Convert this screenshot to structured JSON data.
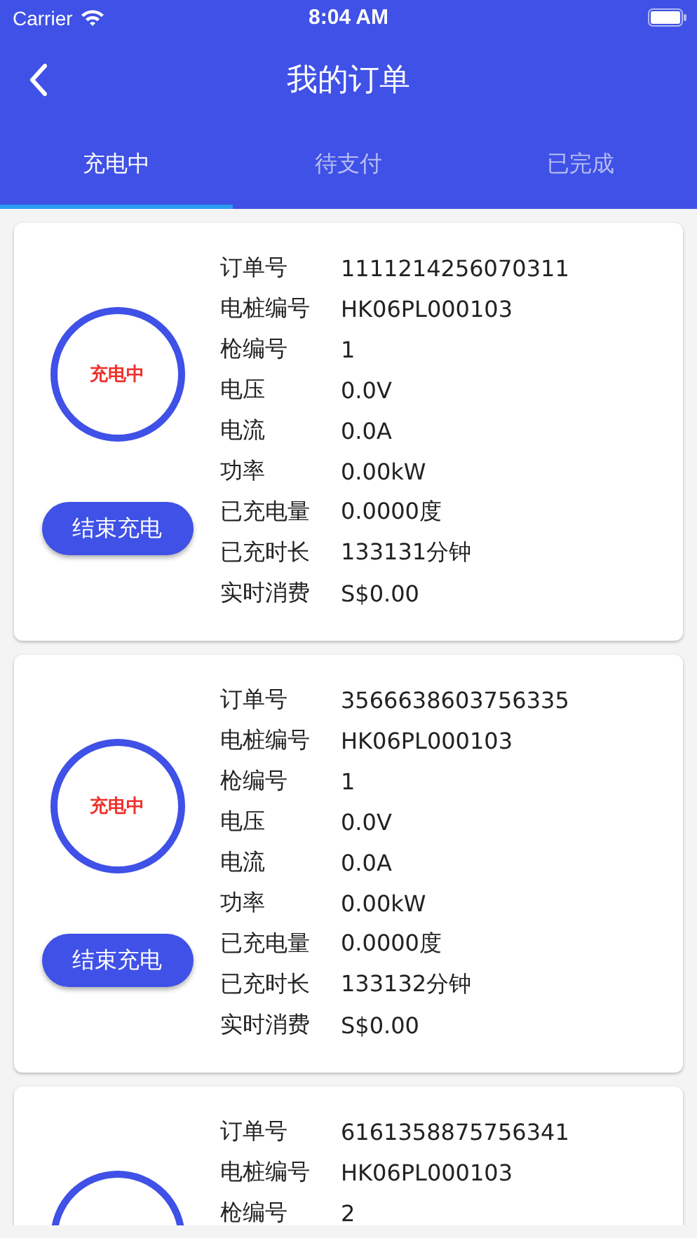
{
  "status_bar": {
    "carrier": "Carrier",
    "time": "8:04 AM"
  },
  "header": {
    "title": "我的订单"
  },
  "tabs": [
    {
      "label": "充电中",
      "selected": true
    },
    {
      "label": "待支付",
      "selected": false
    },
    {
      "label": "已完成",
      "selected": false
    }
  ],
  "orders": [
    {
      "status": "充电中",
      "button": "结束充电",
      "fields": [
        {
          "label": "订单号",
          "value": "1111214256070311"
        },
        {
          "label": "电桩编号",
          "value": "HK06PL000103"
        },
        {
          "label": "枪编号",
          "value": "1"
        },
        {
          "label": "电压",
          "value": "0.0V"
        },
        {
          "label": "电流",
          "value": "0.0A"
        },
        {
          "label": "功率",
          "value": "0.00kW"
        },
        {
          "label": "已充电量",
          "value": "0.0000度"
        },
        {
          "label": "已充时长",
          "value": "133131分钟"
        },
        {
          "label": "实时消费",
          "value": "S$0.00"
        }
      ]
    },
    {
      "status": "充电中",
      "button": "结束充电",
      "fields": [
        {
          "label": "订单号",
          "value": "3566638603756335"
        },
        {
          "label": "电桩编号",
          "value": "HK06PL000103"
        },
        {
          "label": "枪编号",
          "value": "1"
        },
        {
          "label": "电压",
          "value": "0.0V"
        },
        {
          "label": "电流",
          "value": "0.0A"
        },
        {
          "label": "功率",
          "value": "0.00kW"
        },
        {
          "label": "已充电量",
          "value": "0.0000度"
        },
        {
          "label": "已充时长",
          "value": "133132分钟"
        },
        {
          "label": "实时消费",
          "value": "S$0.00"
        }
      ]
    },
    {
      "fields": [
        {
          "label": "订单号",
          "value": "6161358875756341"
        },
        {
          "label": "电桩编号",
          "value": "HK06PL000103"
        },
        {
          "label": "枪编号",
          "value": "2"
        }
      ]
    }
  ]
}
